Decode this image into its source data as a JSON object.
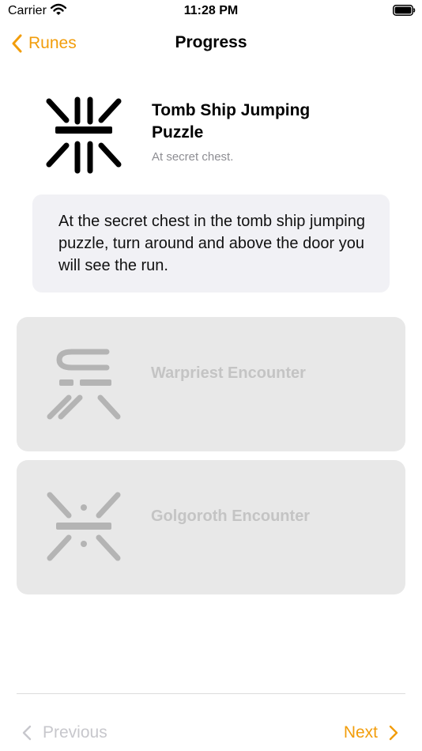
{
  "status_bar": {
    "carrier": "Carrier",
    "time": "11:28 PM"
  },
  "nav": {
    "back_label": "Runes",
    "title": "Progress"
  },
  "hero": {
    "title": "Tomb Ship Jumping Puzzle",
    "subtitle": "At secret chest.",
    "rune_icon": "tomb-ship-rune-icon"
  },
  "note": {
    "text": "At the secret chest in the tomb ship jumping puzzle, turn around and above the door you will see the run."
  },
  "encounters": [
    {
      "label": "Warpriest Encounter",
      "rune_icon": "warpriest-rune-icon"
    },
    {
      "label": "Golgoroth Encounter",
      "rune_icon": "golgoroth-rune-icon"
    }
  ],
  "footer": {
    "previous_label": "Previous",
    "next_label": "Next"
  },
  "colors": {
    "accent": "#f29d0b",
    "card_bg": "#f1f1f5",
    "encounter_bg": "#e8e8e8",
    "disabled_text": "#c4c4c4",
    "rune_inactive": "#b4b4b4"
  }
}
